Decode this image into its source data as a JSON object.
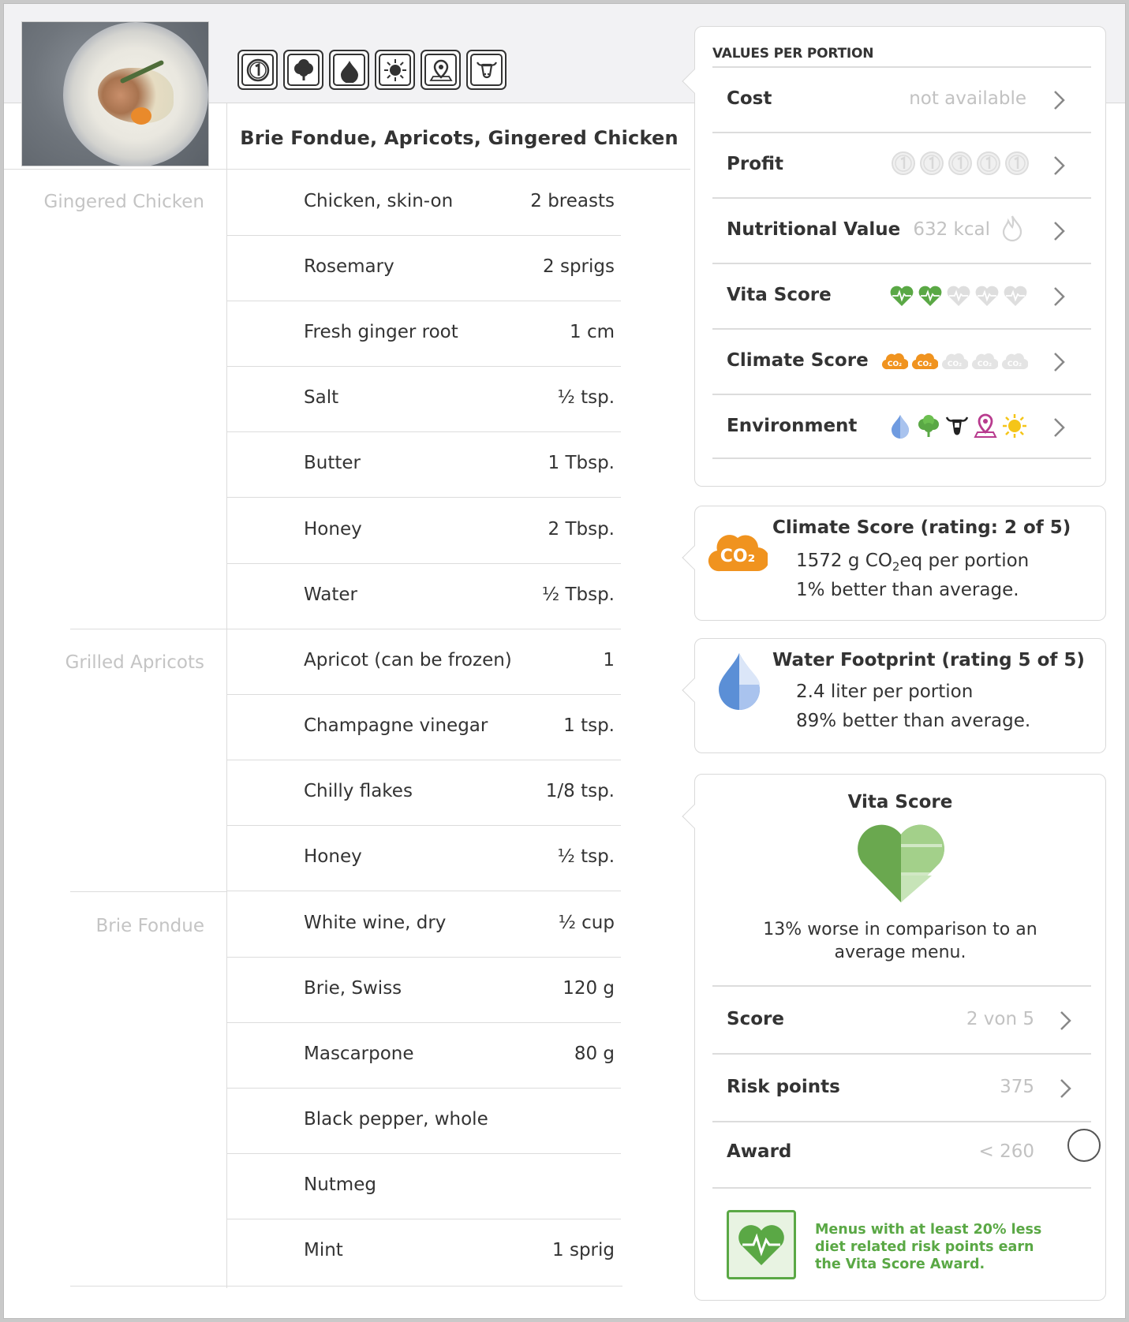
{
  "recipe": {
    "title": "Brie Fondue, Apricots, Gingered Chicken",
    "badges": [
      "number-one-icon",
      "tree-icon",
      "water-drop-icon",
      "sun-icon",
      "location-pin-icon",
      "cow-icon"
    ]
  },
  "groups": [
    {
      "label": "Gingered Chicken",
      "ingredients": [
        {
          "name": "Chicken, skin-on",
          "qty": "2 breasts"
        },
        {
          "name": "Rosemary",
          "qty": "2 sprigs"
        },
        {
          "name": "Fresh ginger root",
          "qty": "1 cm"
        },
        {
          "name": "Salt",
          "qty": "½ tsp."
        },
        {
          "name": "Butter",
          "qty": "1 Tbsp."
        },
        {
          "name": "Honey",
          "qty": "2 Tbsp."
        },
        {
          "name": "Water",
          "qty": "½ Tbsp."
        }
      ]
    },
    {
      "label": "Grilled Apricots",
      "ingredients": [
        {
          "name": "Apricot (can be frozen)",
          "qty": "1"
        },
        {
          "name": "Champagne vinegar",
          "qty": "1 tsp."
        },
        {
          "name": "Chilly flakes",
          "qty": "1/8 tsp."
        },
        {
          "name": "Honey",
          "qty": "½ tsp."
        }
      ]
    },
    {
      "label": "Brie Fondue",
      "ingredients": [
        {
          "name": "White wine, dry",
          "qty": "½ cup"
        },
        {
          "name": "Brie, Swiss",
          "qty": "120 g"
        },
        {
          "name": "Mascarpone",
          "qty": "80 g"
        },
        {
          "name": "Black pepper, whole",
          "qty": ""
        },
        {
          "name": "Nutmeg",
          "qty": ""
        },
        {
          "name": "Mint",
          "qty": "1 sprig"
        }
      ]
    }
  ],
  "values_per_portion": {
    "title": "VALUES PER PORTION",
    "rows": [
      {
        "label": "Cost",
        "value": "not available"
      },
      {
        "label": "Profit",
        "value": "",
        "icon": "coin-icon",
        "count": 5,
        "filled": 0
      },
      {
        "label": "Nutritional Value",
        "value": "632 kcal",
        "icon": "flame-icon"
      },
      {
        "label": "Vita Score",
        "value": "",
        "icon": "heart-pulse-icon",
        "count": 5,
        "filled": 2
      },
      {
        "label": "Climate Score",
        "value": "",
        "icon": "co2-cloud-icon",
        "count": 5,
        "filled": 2
      },
      {
        "label": "Environment",
        "value": "",
        "icons": [
          "water-drop-icon",
          "tree-icon",
          "cow-icon",
          "location-pin-icon",
          "sun-icon"
        ]
      }
    ]
  },
  "climate_card": {
    "title": "Climate Score (rating: 2 of 5)",
    "line1_prefix": "1572 g CO",
    "line1_sub": "2",
    "line1_suffix": "eq per portion",
    "line2": "1% better than average."
  },
  "water_card": {
    "title": "Water Footprint (rating 5 of 5)",
    "line1": "2.4 liter per portion",
    "line2": "89% better than average."
  },
  "vita_card": {
    "title": "Vita Score",
    "description": "13% worse in comparison to an average menu.",
    "rows": [
      {
        "label": "Score",
        "value": "2 von 5"
      },
      {
        "label": "Risk points",
        "value": "375"
      },
      {
        "label": "Award",
        "value": "< 260"
      }
    ],
    "award_text": "Menus with at least 20% less diet related risk points earn the Vita Score Award."
  },
  "colors": {
    "green": "#5aa845",
    "orange": "#f0931f",
    "blue": "#5b8fd6",
    "gray_text": "#c2c2c2",
    "divider": "#dcdcdc"
  }
}
